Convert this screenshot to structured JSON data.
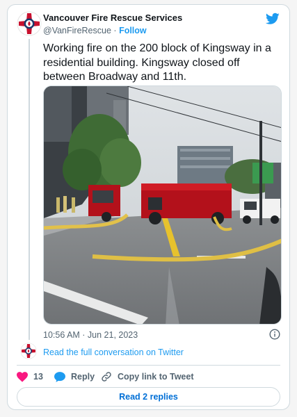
{
  "account": {
    "display_name": "Vancouver Fire Rescue Services",
    "handle": "@VanFireRescue",
    "separator": "·",
    "follow_label": "Follow",
    "avatar_icon": "fire-rescue-badge-icon"
  },
  "tweet": {
    "text": "Working fire on the 200 block of Kingsway in a residential building. Kingsway closed off between Broadway and 11th.",
    "timestamp": "10:56 AM · Jun 21, 2023"
  },
  "conversation": {
    "link_label": "Read the full conversation on Twitter"
  },
  "actions": {
    "like_count": "13",
    "reply_label": "Reply",
    "copy_label": "Copy link to Tweet"
  },
  "footer": {
    "replies_label": "Read 2 replies"
  },
  "colors": {
    "accent": "#1d9bf0",
    "like": "#f91880",
    "muted": "#536471",
    "border": "#cfd9de"
  }
}
